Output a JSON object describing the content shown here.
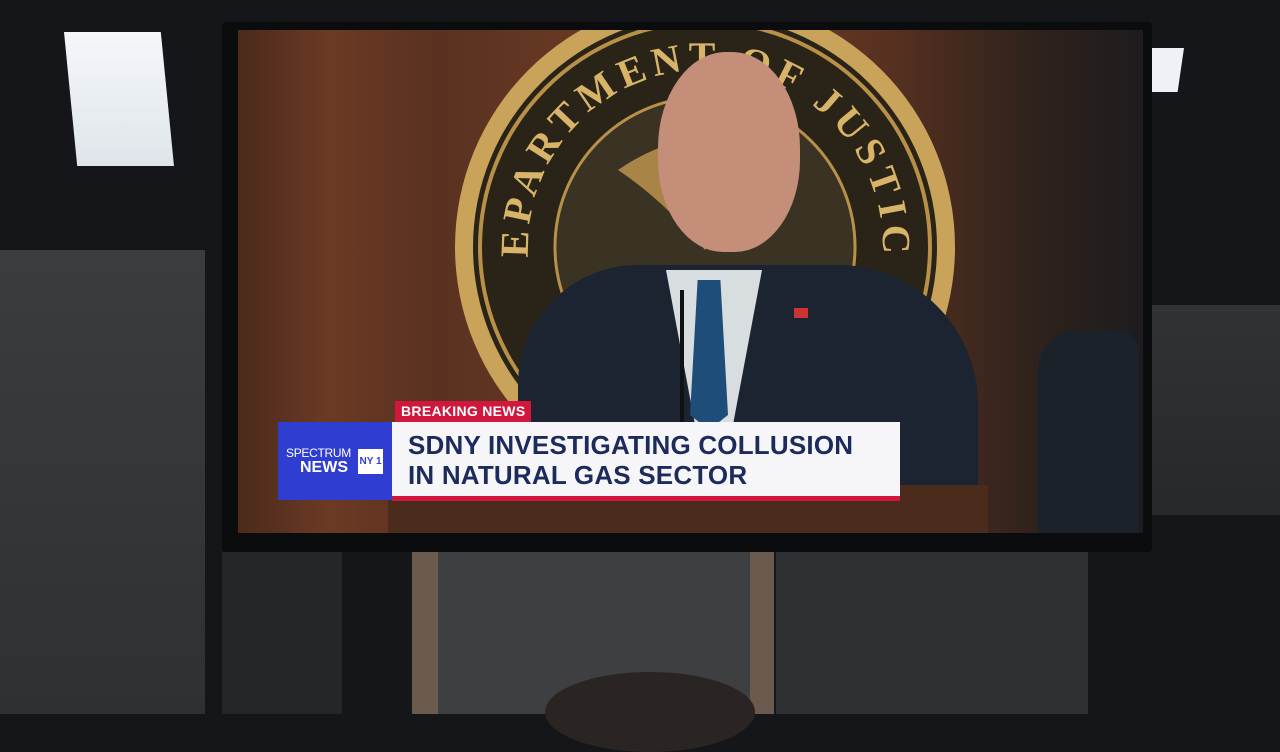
{
  "broadcast": {
    "tag": "BREAKING NEWS",
    "network": {
      "name_top": "SPECTRUM",
      "name_bottom": "NEWS",
      "channel_badge": "NY 1"
    },
    "headline": {
      "line1": "SDNY INVESTIGATING COLLUSION",
      "line2": "IN NATURAL GAS SECTOR"
    }
  },
  "seal": {
    "text": "DEPARTMENT OF JUSTICE"
  },
  "colors": {
    "breaking_red": "#d1183c",
    "network_blue": "#2f3ed1",
    "headline_navy": "#1d2a5c",
    "wood_brown": "#6b3a24",
    "seal_gold": "#c9a35a"
  }
}
